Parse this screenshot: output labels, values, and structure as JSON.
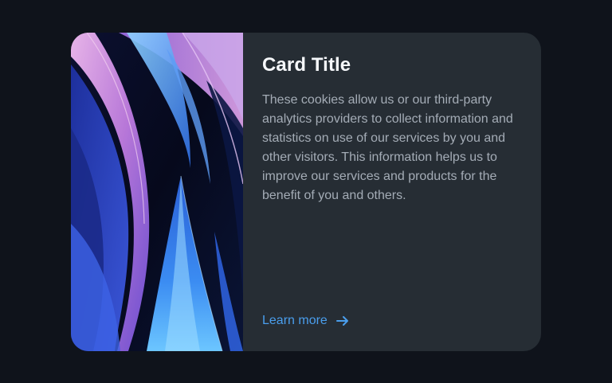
{
  "card": {
    "title": "Card Title",
    "description": "These cookies allow us or our third-party analytics providers to collect information and statistics on use of our services by you and other visitors. This information helps us to improve our services and products for the benefit of you and others.",
    "link_label": "Learn more",
    "link_icon": "arrow-right-icon",
    "image": "abstract-blue-purple-ribbons"
  },
  "colors": {
    "page_background": "#0f131b",
    "card_background": "#262d34",
    "title": "#f5f7fa",
    "body_text": "#a4acb6",
    "link": "#4a9eed"
  }
}
